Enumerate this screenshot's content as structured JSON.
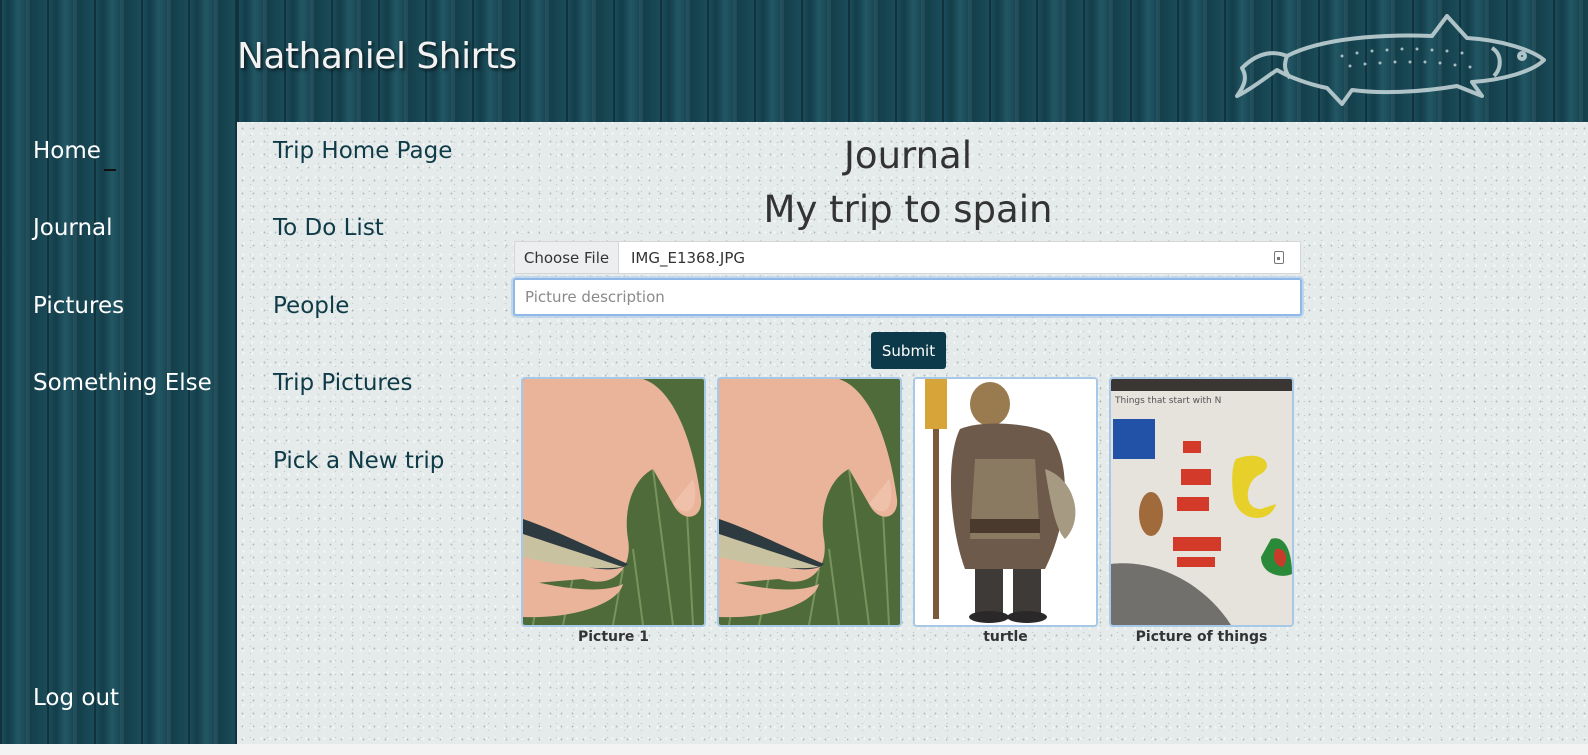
{
  "header": {
    "site_title": "Nathaniel Shirts",
    "logo_icon": "fish-logo-icon"
  },
  "sidebar": {
    "items": [
      {
        "label": "Home"
      },
      {
        "label": "Journal"
      },
      {
        "label": "Pictures"
      },
      {
        "label": "Something Else"
      }
    ],
    "logout_label": "Log out"
  },
  "trip_nav": {
    "items": [
      {
        "label": "Trip Home Page"
      },
      {
        "label": "To Do List"
      },
      {
        "label": "People"
      },
      {
        "label": "Trip Pictures"
      },
      {
        "label": "Pick a New trip"
      }
    ]
  },
  "main": {
    "title": "Journal",
    "subtitle": "My trip to spain",
    "file_input": {
      "button_label": "Choose File",
      "file_name": "IMG_E1368.JPG"
    },
    "description_input": {
      "value": "",
      "placeholder": "Picture description"
    },
    "submit_label": "Submit",
    "pictures": [
      {
        "caption": "Picture 1",
        "image": "hand holding fish"
      },
      {
        "caption": "",
        "image": "hand holding fish"
      },
      {
        "caption": "turtle",
        "image": "armored turtle warrior illustration"
      },
      {
        "caption": "Picture of things",
        "image": "child drawing of colorful shapes"
      }
    ],
    "drawing_text": "Things that start with N"
  },
  "colors": {
    "sidebar_bg": "#1d4f5c",
    "content_bg": "#e4ebea",
    "nav_text": "#0f3a47",
    "submit_bg": "#0d3a4a",
    "focus_border": "#8fb8e8"
  }
}
